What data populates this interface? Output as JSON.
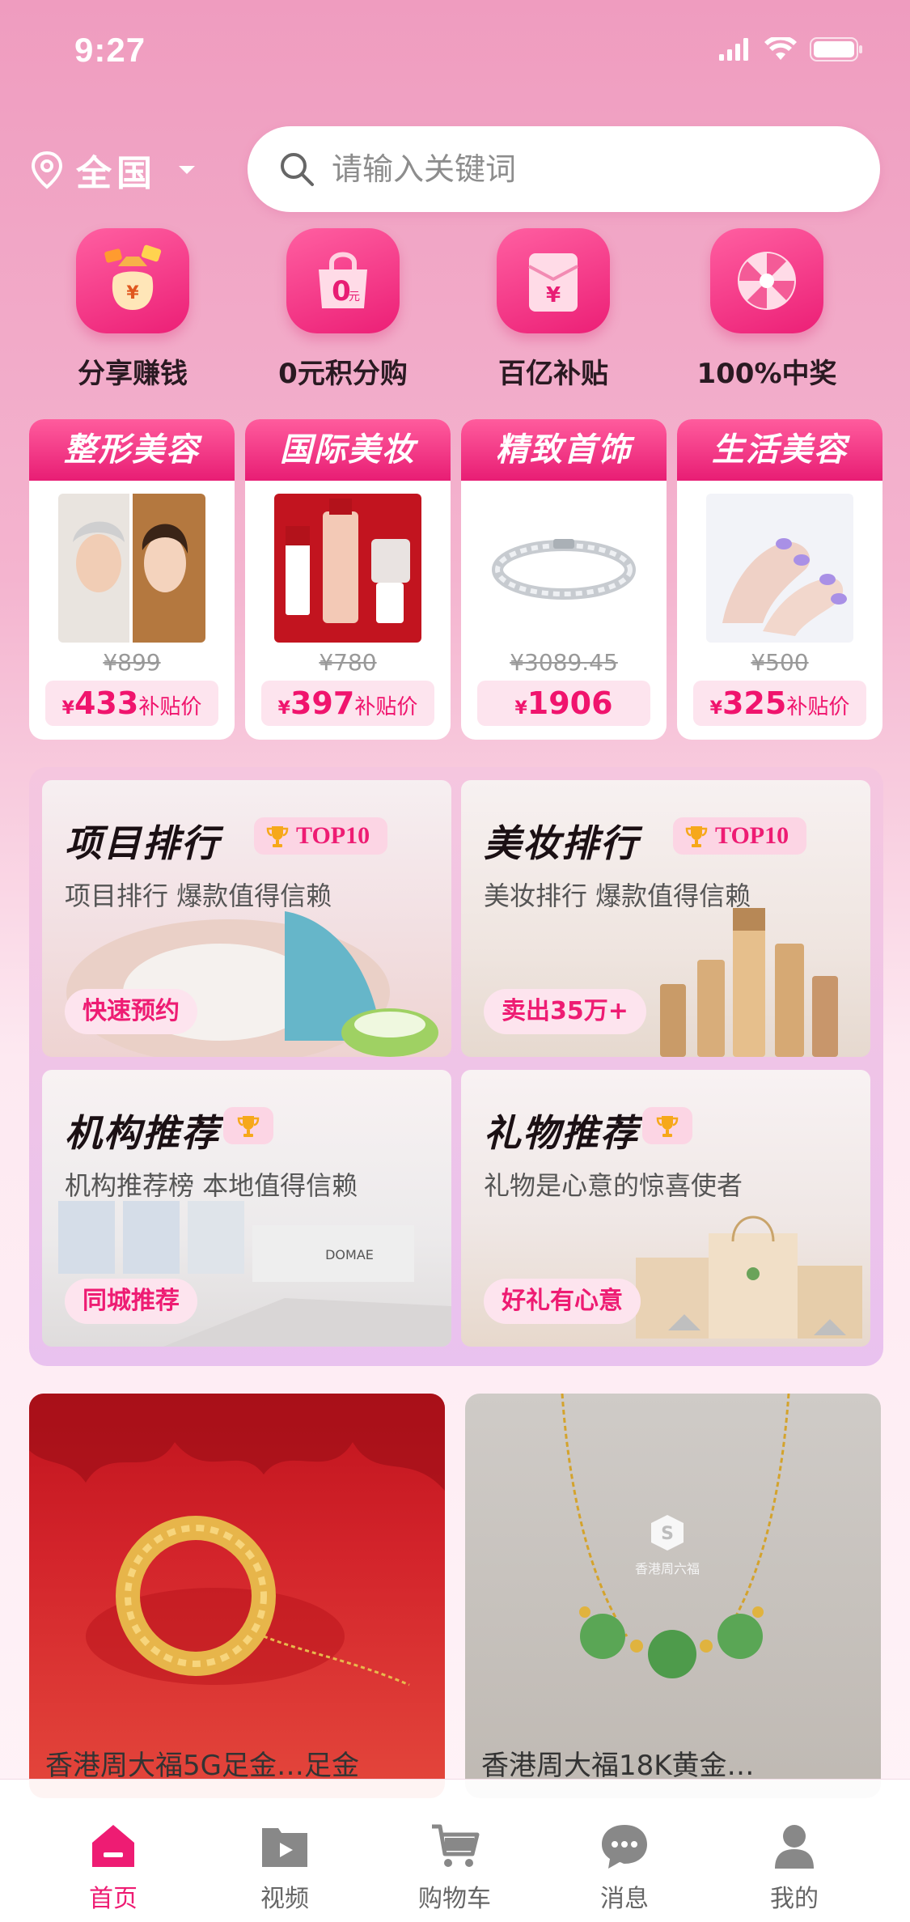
{
  "status_bar": {
    "time": "9:27"
  },
  "header": {
    "location": "全国",
    "search_placeholder": "请输入关键词"
  },
  "quick_entries": [
    {
      "label": "分享赚钱",
      "icon": "money-bag-icon"
    },
    {
      "label": "0元积分购",
      "icon": "shopping-bag-icon",
      "badge": "0元"
    },
    {
      "label": "百亿补贴",
      "icon": "red-envelope-icon"
    },
    {
      "label": "100%中奖",
      "icon": "prize-wheel-icon"
    }
  ],
  "categories": [
    {
      "title": "整形美容",
      "old_price": "¥899",
      "currency": "¥",
      "price": "433",
      "tag": "补贴价"
    },
    {
      "title": "国际美妆",
      "old_price": "¥780",
      "currency": "¥",
      "price": "397",
      "tag": "补贴价"
    },
    {
      "title": "精致首饰",
      "old_price": "¥3089.45",
      "currency": "¥",
      "price": "1906",
      "tag": ""
    },
    {
      "title": "生活美容",
      "old_price": "¥500",
      "currency": "¥",
      "price": "325",
      "tag": "补贴价"
    }
  ],
  "rankings": [
    {
      "title": "项目排行",
      "badge": "TOP10",
      "subtitle": "项目排行 爆款值得信赖",
      "button": "快速预约"
    },
    {
      "title": "美妆排行",
      "badge": "TOP10",
      "subtitle": "美妆排行 爆款值得信赖",
      "button": "卖出35万+"
    },
    {
      "title": "机构推荐",
      "badge": "",
      "subtitle": "机构推荐榜 本地值得信赖",
      "button": "同城推荐"
    },
    {
      "title": "礼物推荐",
      "badge": "",
      "subtitle": "礼物是心意的惊喜使者",
      "button": "好礼有心意"
    }
  ],
  "products": [
    {
      "title": "香港周大福5G足金…足金"
    },
    {
      "title": "香港周大福18K黄金…"
    }
  ],
  "tabbar": [
    {
      "label": "首页",
      "icon": "home-icon",
      "active": true
    },
    {
      "label": "视频",
      "icon": "video-icon",
      "active": false
    },
    {
      "label": "购物车",
      "icon": "cart-icon",
      "active": false
    },
    {
      "label": "消息",
      "icon": "message-icon",
      "active": false
    },
    {
      "label": "我的",
      "icon": "profile-icon",
      "active": false
    }
  ],
  "colors": {
    "accent": "#ee1c73",
    "accent_light": "#fde4ee",
    "header_gradient_top": "#ef9cbf"
  }
}
